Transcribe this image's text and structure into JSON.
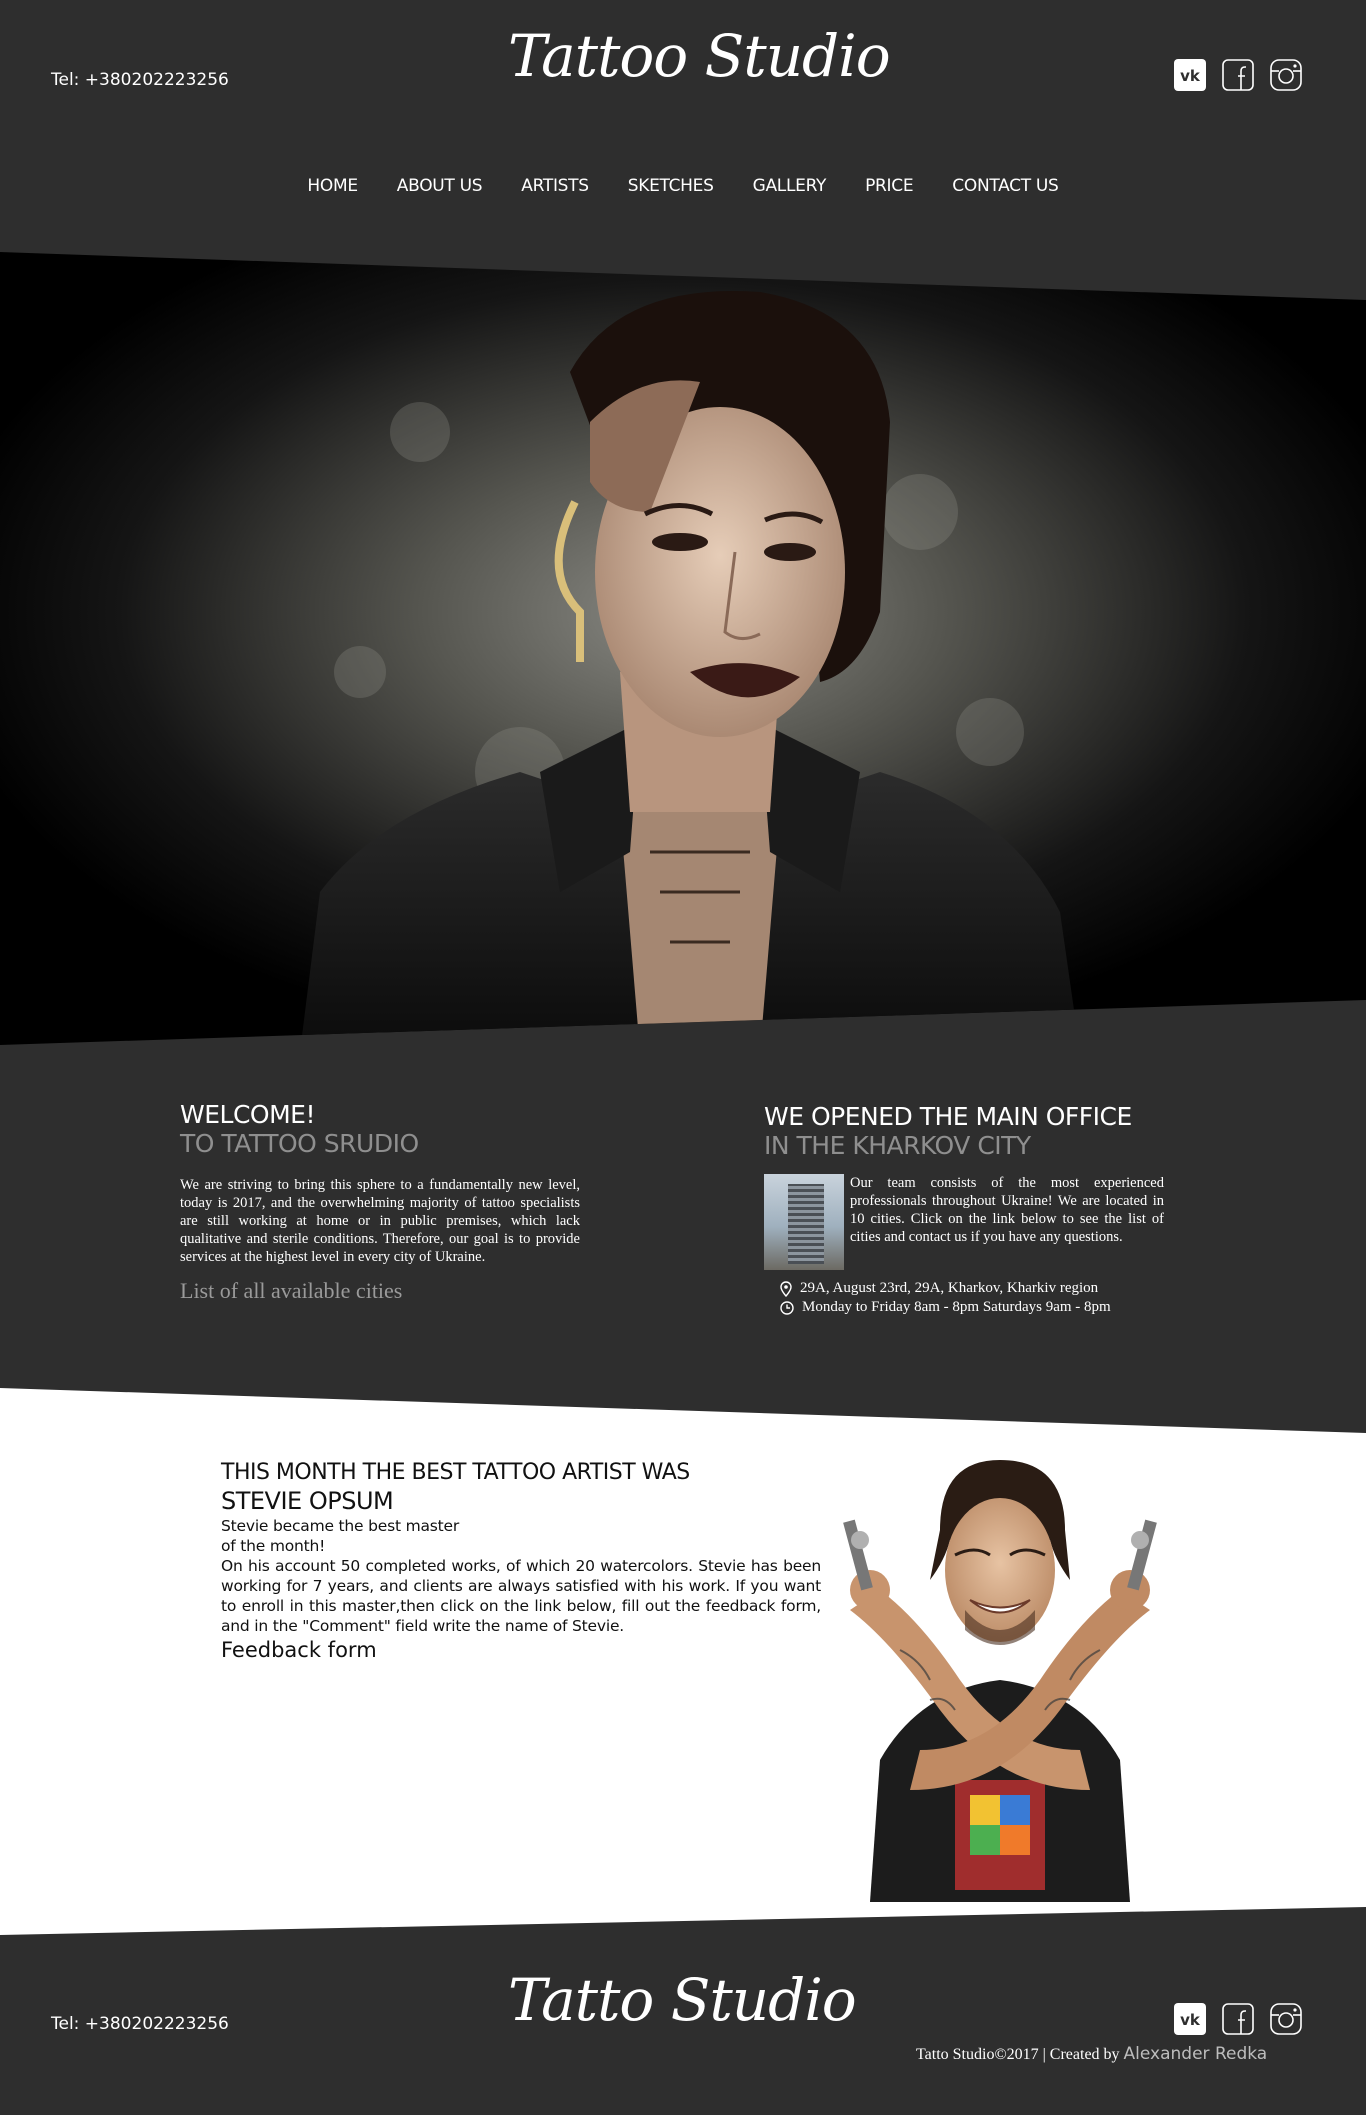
{
  "header": {
    "phone": "Tel: +380202223256",
    "logo": "Tattoo Studio",
    "social": [
      "vk-icon",
      "facebook-icon",
      "instagram-icon"
    ]
  },
  "nav": {
    "items": [
      "HOME",
      "ABOUT US",
      "ARTISTS",
      "SKETCHES",
      "GALLERY",
      "PRICE",
      "CONTACT US"
    ]
  },
  "welcome": {
    "title": "WELCOME!",
    "subtitle": "TO TATTOO SRUDIO",
    "text": "We are striving to bring this sphere to a fundamentally new level, today is 2017, and the overwhelming majority of tattoo specialists are still working at home or in public premises, which lack qualitative and sterile conditions. Therefore, our goal is to provide services at the highest level in every city of Ukraine.",
    "link": "List of all available cities"
  },
  "office": {
    "title": "WE OPENED THE MAIN OFFICE",
    "subtitle": "IN THE KHARKOV CITY",
    "text": "Our team consists of the most experienced professionals throughout Ukraine! We are located in 10 cities. Click on the link below to see the list of cities and contact us if you have any questions.",
    "address": "29A, August 23rd, 29A, Kharkov, Kharkiv region",
    "hours": "Monday to Friday 8am - 8pm Saturdays 9am - 8pm"
  },
  "artist": {
    "title_line1": "THIS MONTH THE BEST TATTOO ARTIST WAS",
    "title_line2": "STEVIE OPSUM",
    "intro_line1": "Stevie became the best master",
    "intro_line2": "of the month!",
    "text": "On his account 50 completed works, of which 20 watercolors. Stevie has been working for 7 years, and clients are always satisfied with his work. If you want to enroll in this master,then click on the link below, fill out the feedback form, and in the \"Comment\" field write the name of Stevie.",
    "link": "Feedback form"
  },
  "footer": {
    "phone": "Tel: +380202223256",
    "logo": "Tatto Studio",
    "copyright": "Tatto Studio©2017 | Created by",
    "author": "Alexander Redka"
  },
  "colors": {
    "background": "#2e2e2e",
    "light_section": "#ffffff",
    "muted_heading": "#8f8f8f"
  }
}
